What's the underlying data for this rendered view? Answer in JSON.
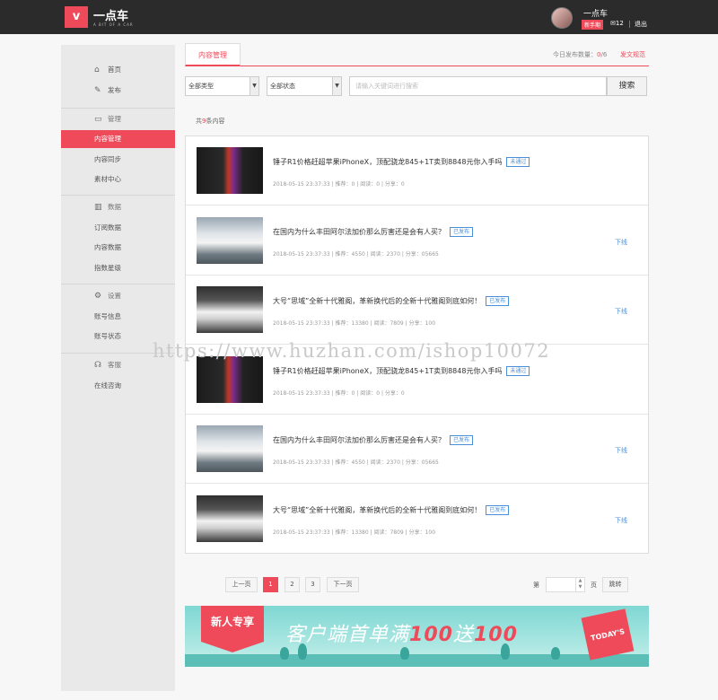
{
  "header": {
    "logo_text": "一点车",
    "logo_sub": "A BIT OF A CAR",
    "user_name": "一点车",
    "user_level": "新手期",
    "message_count": "12",
    "logout": "退出"
  },
  "sidebar": {
    "home": "首页",
    "publish": "发布",
    "manage_header": "管理",
    "content_manage": "内容管理",
    "content_sync": "内容同步",
    "material_center": "素材中心",
    "data_header": "数据",
    "subscription_data": "订阅数据",
    "content_data": "内容数据",
    "index_level": "指数星级",
    "settings_header": "设置",
    "account_info": "账号信息",
    "account_status": "账号状态",
    "service_header": "客服",
    "online_consult": "在线咨询"
  },
  "tabs": {
    "active": "内容管理"
  },
  "publish_info": {
    "label": "今日发布数量：",
    "count": "0",
    "unit": "/6",
    "spec_link": "发文规范"
  },
  "filters": {
    "type_value": "全部类型",
    "status_value": "全部状态",
    "search_placeholder": "请输入关键词进行搜索",
    "search_button": "搜索"
  },
  "summary": {
    "prefix": "共",
    "count": "9",
    "suffix": "条内容"
  },
  "articles": [
    {
      "title": "锤子R1价格赶超苹果iPhoneX，顶配骁龙845+1T卖到8848元你入手吗",
      "status": "未通过",
      "meta": "2018-05-15 23:37:33 | 推荐：0 | 阅读：0 | 分享：0",
      "action": ""
    },
    {
      "title": "在国内为什么丰田阿尔法加价那么厉害还是会有人买？",
      "status": "已发布",
      "meta": "2018-05-15 23:37:33 | 推荐：4550 | 阅读：2370 | 分享：05665",
      "action": "下线"
    },
    {
      "title": "大号“思域”全新十代雅阁，革新换代后的全新十代雅阁到底如何！",
      "status": "已发布",
      "meta": "2018-05-15 23:37:33 | 推荐：13380 | 阅读：7809 | 分享：100",
      "action": "下线"
    },
    {
      "title": "锤子R1价格赶超苹果iPhoneX，顶配骁龙845+1T卖到8848元你入手吗",
      "status": "未通过",
      "meta": "2018-05-15 23:37:33 | 推荐：0 | 阅读：0 | 分享：0",
      "action": ""
    },
    {
      "title": "在国内为什么丰田阿尔法加价那么厉害还是会有人买？",
      "status": "已发布",
      "meta": "2018-05-15 23:37:33 | 推荐：4550 | 阅读：2370 | 分享：05665",
      "action": "下线"
    },
    {
      "title": "大号“思域”全新十代雅阁，革新换代后的全新十代雅阁到底如何！",
      "status": "已发布",
      "meta": "2018-05-15 23:37:33 | 推荐：13380 | 阅读：7809 | 分享：100",
      "action": "下线"
    }
  ],
  "watermark": "https://www.huzhan.com/ishop10072",
  "pagination": {
    "prev": "上一页",
    "pages": [
      "1",
      "2",
      "3"
    ],
    "next": "下一页",
    "page_label": "第",
    "page_unit": "页",
    "go": "跳转"
  },
  "banner": {
    "badge": "新人专享",
    "text_pre": "客户端首单满",
    "num1": "100",
    "text_mid": "送",
    "num2": "100",
    "bag_text": "TODAY'S"
  },
  "colors": {
    "accent": "#ee4a5a",
    "link": "#4a90d9",
    "topbar": "#2b2b2b"
  }
}
